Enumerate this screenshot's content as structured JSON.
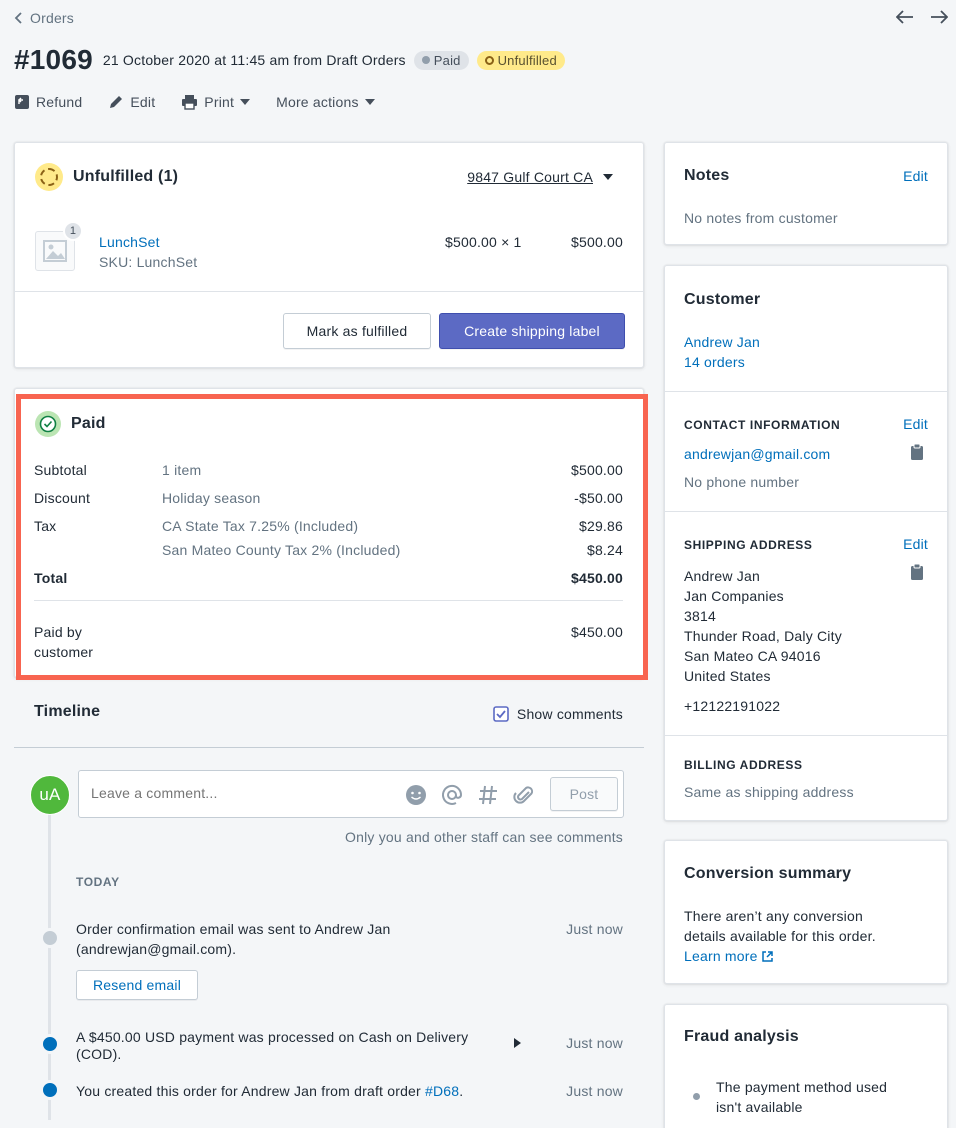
{
  "nav": {
    "back_label": "Orders"
  },
  "order": {
    "number": "#1069",
    "meta": "21 October 2020 at 11:45 am from Draft Orders",
    "badge_paid": "Paid",
    "badge_unfulfilled": "Unfulfilled"
  },
  "actions": {
    "refund": "Refund",
    "edit": "Edit",
    "print": "Print",
    "more": "More actions"
  },
  "fulfillment": {
    "title": "Unfulfilled (1)",
    "location": "9847 Gulf Court CA",
    "item_name": "LunchSet",
    "item_sku": "SKU: LunchSet",
    "item_qty_badge": "1",
    "item_price_qty": "$500.00 × 1",
    "item_total": "$500.00",
    "mark_fulfilled": "Mark as fulfilled",
    "create_label": "Create shipping label"
  },
  "payment": {
    "title": "Paid",
    "rows": [
      {
        "label": "Subtotal",
        "desc": "1 item",
        "amount": "$500.00"
      },
      {
        "label": "Discount",
        "desc": "Holiday season",
        "amount": "-$50.00"
      },
      {
        "label": "Tax",
        "desc": "CA State Tax 7.25% (Included)",
        "amount": "$29.86"
      },
      {
        "label": "",
        "desc": "San Mateo County Tax 2% (Included)",
        "amount": "$8.24"
      }
    ],
    "total_label": "Total",
    "total_amount": "$450.00",
    "paid_by_line1": "Paid by",
    "paid_by_line2": "customer",
    "paid_amount": "$450.00"
  },
  "highlight_color": "#f86450",
  "timeline": {
    "title": "Timeline",
    "show_comments": "Show comments",
    "avatar": "uA",
    "comment_placeholder": "Leave a comment...",
    "post": "Post",
    "staff_note": "Only you and other staff can see comments",
    "today": "TODAY",
    "events": [
      {
        "line1": "Order confirmation email was sent to Andrew Jan",
        "line2": "(andrewjan@gmail.com).",
        "time": "Just now",
        "button": "Resend email"
      },
      {
        "line1": "A $450.00 USD payment was processed on Cash on Delivery",
        "line2": "(COD).",
        "time": "Just now"
      },
      {
        "line1": "You created this order for Andrew Jan from draft order ",
        "link": "#D68",
        "suffix": ".",
        "time": "Just now"
      }
    ]
  },
  "notes": {
    "title": "Notes",
    "edit": "Edit",
    "body": "No notes from customer"
  },
  "customer": {
    "title": "Customer",
    "name": "Andrew Jan",
    "orders": "14 orders",
    "contact_title": "CONTACT INFORMATION",
    "contact_edit": "Edit",
    "email": "andrewjan@gmail.com",
    "phone": "No phone number",
    "shipping_title": "SHIPPING ADDRESS",
    "shipping_edit": "Edit",
    "shipping_lines": [
      "Andrew Jan",
      "Jan Companies",
      "3814",
      "Thunder Road, Daly City",
      "San Mateo CA 94016",
      "United States"
    ],
    "shipping_phone": "+12122191022",
    "billing_title": "BILLING ADDRESS",
    "billing_body": "Same as shipping address"
  },
  "conversion": {
    "title": "Conversion summary",
    "line1": "There aren’t any conversion",
    "line2": "details available for this order.",
    "learn_more": "Learn more"
  },
  "fraud": {
    "title": "Fraud analysis",
    "line1": "The payment method used",
    "line2": "isn't available"
  }
}
